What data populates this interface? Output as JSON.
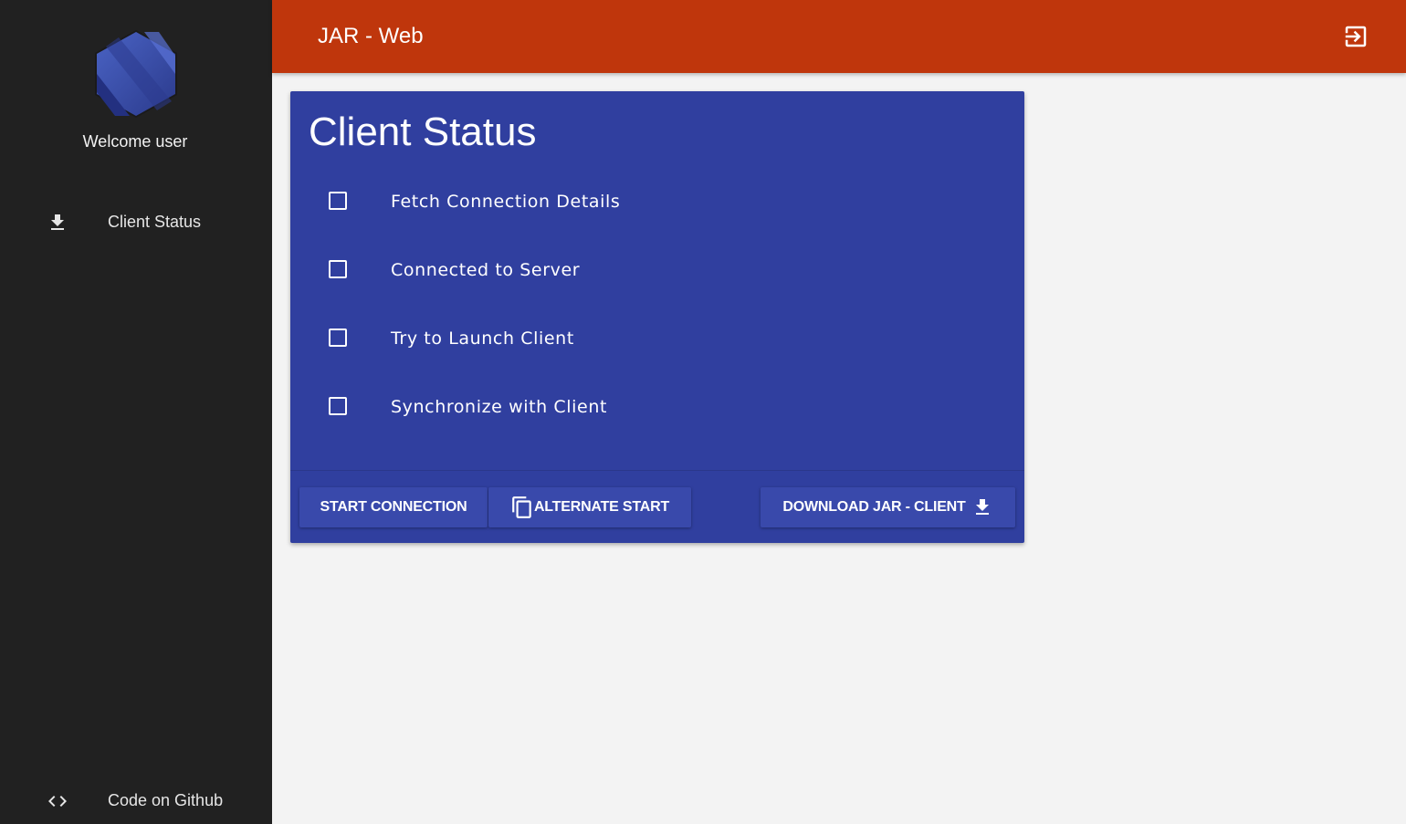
{
  "sidebar": {
    "logo": "app-logo",
    "welcome": "Welcome user",
    "items": [
      {
        "label": "Client Status",
        "icon": "download-icon"
      }
    ],
    "footer": {
      "label": "Code on Github",
      "icon": "code-icon"
    }
  },
  "header": {
    "title": "JAR - Web",
    "logout_icon": "exit-to-app-icon"
  },
  "card": {
    "title": "Client Status",
    "checklist": [
      {
        "label": "Fetch Connection Details",
        "checked": false
      },
      {
        "label": "Connected to Server",
        "checked": false
      },
      {
        "label": "Try to Launch Client",
        "checked": false
      },
      {
        "label": "Synchronize with Client",
        "checked": false
      }
    ],
    "actions": {
      "start": "START CONNECTION",
      "alternate": "ALTERNATE START",
      "download": "DOWNLOAD JAR - CLIENT"
    }
  },
  "colors": {
    "sidebar_bg": "#212121",
    "topbar_bg": "#bf360c",
    "card_bg": "#303f9f",
    "button_bg": "#3949ab",
    "page_bg": "#f3f3f3"
  }
}
